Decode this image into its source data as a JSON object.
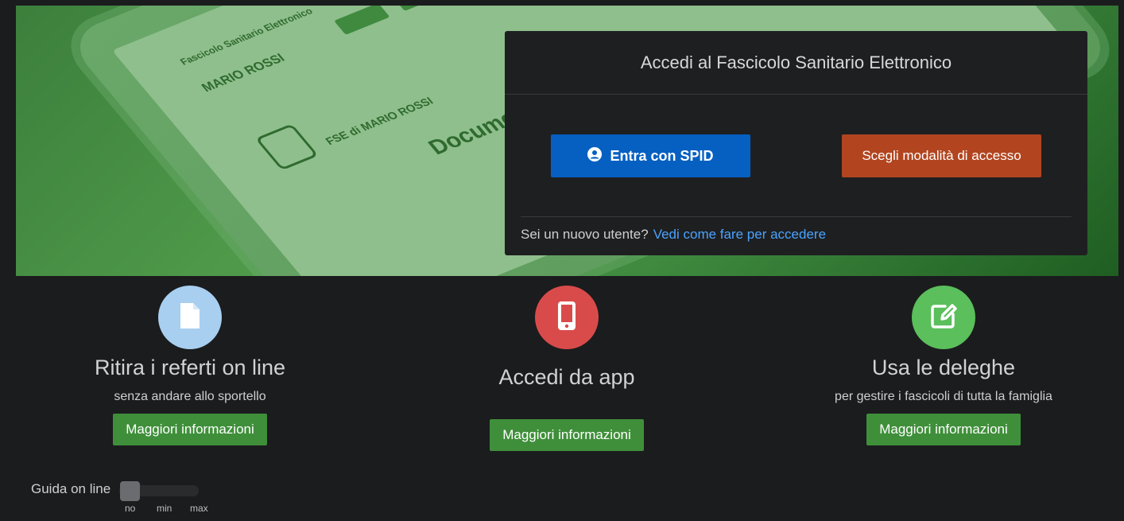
{
  "hero": {
    "tablet_texts": [
      "Fascicolo Sanitario Elettronico",
      "MARIO ROSSI",
      "FSE di MARIO ROSSI",
      "Documenti"
    ]
  },
  "login": {
    "title": "Accedi al Fascicolo Sanitario Elettronico",
    "spid_label": "Entra con SPID",
    "alt_label": "Scegli modalità di accesso",
    "footer_text": "Sei un nuovo utente?",
    "footer_link": "Vedi come fare per accedere"
  },
  "features": [
    {
      "title": "Ritira i referti on line",
      "subtitle": "senza andare allo sportello",
      "button": "Maggiori informazioni",
      "icon": "document-icon",
      "color": "#a8cff0"
    },
    {
      "title": "Accedi da app",
      "subtitle": "",
      "button": "Maggiori informazioni",
      "icon": "mobile-icon",
      "color": "#d94b4b"
    },
    {
      "title": "Usa le deleghe",
      "subtitle": "per gestire i fascicoli di tutta la famiglia",
      "button": "Maggiori informazioni",
      "icon": "edit-icon",
      "color": "#5bbf5b"
    }
  ],
  "guide": {
    "label": "Guida on line",
    "levels": [
      "no",
      "min",
      "max"
    ],
    "selected": "no"
  },
  "colors": {
    "spid_blue": "#0560c2",
    "alt_orange": "#b2451f",
    "info_green": "#3f8f3a",
    "link_blue": "#4aa3ff"
  }
}
